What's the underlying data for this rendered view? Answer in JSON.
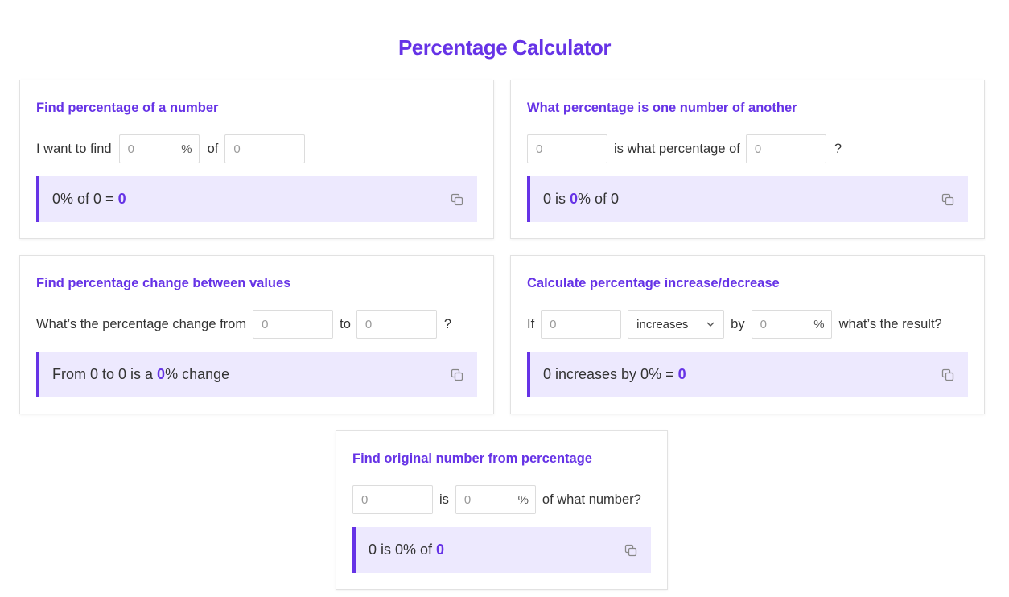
{
  "page": {
    "title": "Percentage Calculator"
  },
  "colors": {
    "accent": "#6633e6",
    "result_bg": "#ede9fe",
    "border": "#e2e2e2"
  },
  "icons": {
    "copy": "copy-icon",
    "select_arrow": "chevron-down-icon"
  },
  "cards": [
    {
      "title": "Find percentage of a number",
      "text1": "I want to find",
      "input1_placeholder": "0",
      "pct_sign": "%",
      "text2": "of",
      "input2_placeholder": "0",
      "result_pre": "0% of 0 = ",
      "result_value": "0",
      "result_post": ""
    },
    {
      "title": "What percentage is one number of another",
      "input1_placeholder": "0",
      "text1": "is what percentage of",
      "input2_placeholder": "0",
      "text2": "?",
      "result_pre": "0 is ",
      "result_value": "0",
      "result_post": "% of 0"
    },
    {
      "title": "Find percentage change between values",
      "text1": "What’s the percentage change from",
      "input1_placeholder": "0",
      "text2": "to",
      "input2_placeholder": "0",
      "text3": "?",
      "result_pre": "From 0 to 0 is a ",
      "result_value": "0",
      "result_post": "% change"
    },
    {
      "title": "Calculate percentage increase/decrease",
      "text1": "If",
      "input1_placeholder": "0",
      "select_value": "increases",
      "text2": "by",
      "input2_placeholder": "0",
      "pct_sign": "%",
      "text3": "what’s the result?",
      "result_pre": "0 increases by 0% = ",
      "result_value": "0",
      "result_post": ""
    },
    {
      "title": "Find original number from percentage",
      "input1_placeholder": "0",
      "text1": "is",
      "input2_placeholder": "0",
      "pct_sign": "%",
      "text2": "of what number?",
      "result_pre": "0 is 0% of ",
      "result_value": "0",
      "result_post": ""
    }
  ]
}
